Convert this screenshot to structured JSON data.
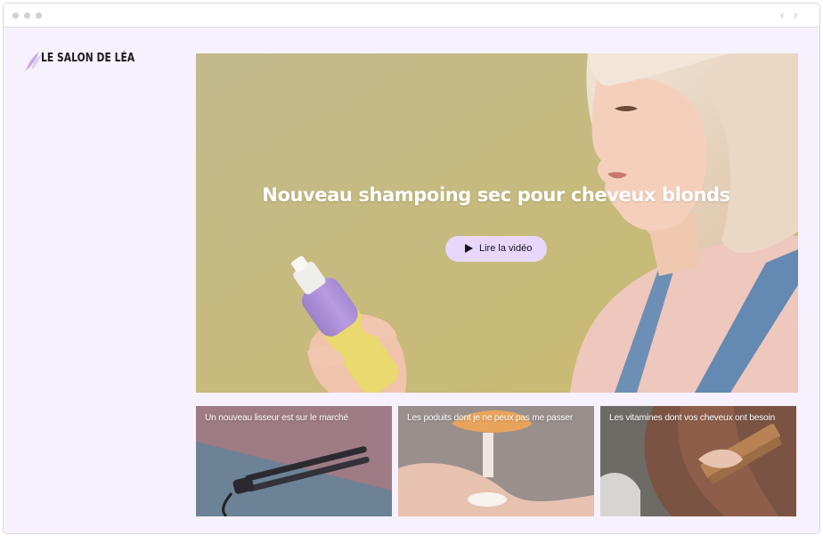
{
  "browser": {
    "back_icon": "chevron-left-icon",
    "forward_icon": "chevron-right-icon",
    "back_glyph": "‹",
    "forward_glyph": "›"
  },
  "site": {
    "logo_text": "LE SALON DE LÉA",
    "logo_icon": "feather-icon"
  },
  "hero": {
    "title": "Nouveau shampoing sec pour cheveux blonds",
    "play_label": "Lire la vidéo",
    "play_icon": "play-icon",
    "image_description_colors": {
      "background": "#c8be8a",
      "bottle": "#a98fd0",
      "hair": "#ecdcc9"
    }
  },
  "articles": [
    {
      "title": "Un nouveau lisseur est sur le marché"
    },
    {
      "title": "Les poduits dont je ne peux pas me passer"
    },
    {
      "title": "Les vitamines dont vos cheveux ont besoin"
    }
  ],
  "colors": {
    "page_background": "#f7f1fd",
    "accent": "#e9d7fb",
    "logo_mark": "#c9a6ef"
  }
}
